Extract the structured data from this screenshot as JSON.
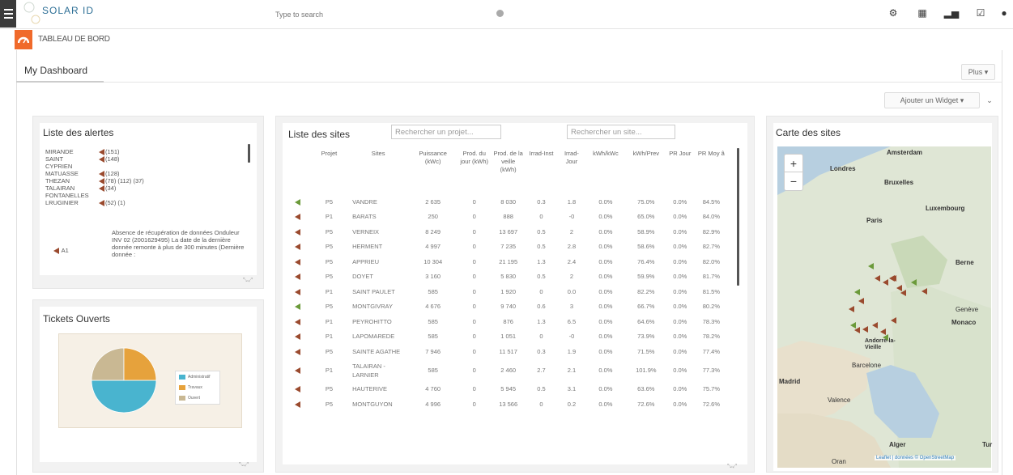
{
  "header": {
    "logo_text": "SOLAR ID",
    "search_placeholder": "Type to search",
    "icons": [
      "gear-icon",
      "calendar-icon",
      "chart-icon",
      "checkbox-icon",
      "user-icon"
    ]
  },
  "tab": {
    "title": "TABLEAU DE BORD"
  },
  "dashboard": {
    "title": "My Dashboard",
    "plus_label": "Plus ▾",
    "add_widget_label": "Ajouter un Widget ▾"
  },
  "alerts": {
    "title": "Liste des alertes",
    "rows": [
      {
        "name": "MIRANDE",
        "flags": "(151)"
      },
      {
        "name": "SAINT",
        "flags": "(148)"
      },
      {
        "name": "CYPRIEN",
        "flags": ""
      },
      {
        "name": "MATUASSE",
        "flags": "(128)"
      },
      {
        "name": "THEZAN",
        "flags": "(78)  (112)  (37)"
      },
      {
        "name": "TALAIRAN",
        "flags": "(34)"
      },
      {
        "name": "FONTANELLES",
        "flags": ""
      },
      {
        "name": "LRUGINIER",
        "flags": "(52)  (1)"
      }
    ],
    "message": "Absence de récupération de données Onduleur INV 02 (2001629495) La date de la dernière donnée remonte à plus de 300 minutes (Dernière donnée :",
    "a1_label": "A1"
  },
  "tickets": {
    "title": "Tickets Ouverts",
    "legend": [
      "Administratif",
      "Travaux",
      "Ouvert"
    ],
    "colors": {
      "administratif": "#49b4cf",
      "travaux": "#e6a23c",
      "ouvert": "#c9b893"
    },
    "values": {
      "administratif": 50,
      "travaux": 25,
      "ouvert": 25
    }
  },
  "sites": {
    "title": "Liste des sites",
    "project_placeholder": "Rechercher un projet...",
    "site_placeholder": "Rechercher un site...",
    "columns": [
      "Projet",
      "Sites",
      "Puissance (kWc)",
      "Prod. du jour (kWh)",
      "Prod. de la veille (kWh)",
      "Irrad-Inst",
      "Irrad-Jour",
      "kWh/kWc",
      "kWh/Prev",
      "PR Jour",
      "PR Moy â"
    ],
    "rows": [
      {
        "flag": "g",
        "projet": "P5",
        "site": "VANDRE",
        "puissance": "2 635",
        "prod_jour": "0",
        "prod_veille": "8 030",
        "irr_inst": "0.3",
        "irr_jour": "1.8",
        "kwh_kwc": "0.0%",
        "kwh_prev": "75.0%",
        "pr_jour": "0.0%",
        "pr_moy": "84.5%"
      },
      {
        "flag": "r",
        "projet": "P1",
        "site": "BARATS",
        "puissance": "250",
        "prod_jour": "0",
        "prod_veille": "888",
        "irr_inst": "0",
        "irr_jour": "-0",
        "kwh_kwc": "0.0%",
        "kwh_prev": "65.0%",
        "pr_jour": "0.0%",
        "pr_moy": "84.0%"
      },
      {
        "flag": "r",
        "projet": "P5",
        "site": "VERNEIX",
        "puissance": "8 249",
        "prod_jour": "0",
        "prod_veille": "13 697",
        "irr_inst": "0.5",
        "irr_jour": "2",
        "kwh_kwc": "0.0%",
        "kwh_prev": "58.9%",
        "pr_jour": "0.0%",
        "pr_moy": "82.9%"
      },
      {
        "flag": "r",
        "projet": "P5",
        "site": "HERMENT",
        "puissance": "4 997",
        "prod_jour": "0",
        "prod_veille": "7 235",
        "irr_inst": "0.5",
        "irr_jour": "2.8",
        "kwh_kwc": "0.0%",
        "kwh_prev": "58.6%",
        "pr_jour": "0.0%",
        "pr_moy": "82.7%"
      },
      {
        "flag": "r",
        "projet": "P5",
        "site": "APPRIEU",
        "puissance": "10 304",
        "prod_jour": "0",
        "prod_veille": "21 195",
        "irr_inst": "1.3",
        "irr_jour": "2.4",
        "kwh_kwc": "0.0%",
        "kwh_prev": "76.4%",
        "pr_jour": "0.0%",
        "pr_moy": "82.0%"
      },
      {
        "flag": "r",
        "projet": "P5",
        "site": "DOYET",
        "puissance": "3 160",
        "prod_jour": "0",
        "prod_veille": "5 830",
        "irr_inst": "0.5",
        "irr_jour": "2",
        "kwh_kwc": "0.0%",
        "kwh_prev": "59.9%",
        "pr_jour": "0.0%",
        "pr_moy": "81.7%"
      },
      {
        "flag": "r",
        "projet": "P1",
        "site": "SAINT PAULET",
        "puissance": "585",
        "prod_jour": "0",
        "prod_veille": "1 920",
        "irr_inst": "0",
        "irr_jour": "0.0",
        "kwh_kwc": "0.0%",
        "kwh_prev": "82.2%",
        "pr_jour": "0.0%",
        "pr_moy": "81.5%"
      },
      {
        "flag": "g",
        "projet": "P5",
        "site": "MONTGIVRAY",
        "puissance": "4 676",
        "prod_jour": "0",
        "prod_veille": "9 740",
        "irr_inst": "0.6",
        "irr_jour": "3",
        "kwh_kwc": "0.0%",
        "kwh_prev": "66.7%",
        "pr_jour": "0.0%",
        "pr_moy": "80.2%"
      },
      {
        "flag": "r",
        "projet": "P1",
        "site": "PEYROHITTO",
        "puissance": "585",
        "prod_jour": "0",
        "prod_veille": "876",
        "irr_inst": "1.3",
        "irr_jour": "6.5",
        "kwh_kwc": "0.0%",
        "kwh_prev": "64.6%",
        "pr_jour": "0.0%",
        "pr_moy": "78.3%"
      },
      {
        "flag": "r",
        "projet": "P1",
        "site": "LAPOMAREDE",
        "puissance": "585",
        "prod_jour": "0",
        "prod_veille": "1 051",
        "irr_inst": "0",
        "irr_jour": "-0",
        "kwh_kwc": "0.0%",
        "kwh_prev": "73.9%",
        "pr_jour": "0.0%",
        "pr_moy": "78.2%"
      },
      {
        "flag": "r",
        "projet": "P5",
        "site": "SAINTE AGATHE",
        "puissance": "7 946",
        "prod_jour": "0",
        "prod_veille": "11 517",
        "irr_inst": "0.3",
        "irr_jour": "1.9",
        "kwh_kwc": "0.0%",
        "kwh_prev": "71.5%",
        "pr_jour": "0.0%",
        "pr_moy": "77.4%"
      },
      {
        "flag": "r",
        "projet": "P1",
        "site": "TALAIRAN - LARNIER",
        "puissance": "585",
        "prod_jour": "0",
        "prod_veille": "2 460",
        "irr_inst": "2.7",
        "irr_jour": "2.1",
        "kwh_kwc": "0.0%",
        "kwh_prev": "101.9%",
        "pr_jour": "0.0%",
        "pr_moy": "77.3%",
        "tall": true
      },
      {
        "flag": "r",
        "projet": "P5",
        "site": "HAUTERIVE",
        "puissance": "4 760",
        "prod_jour": "0",
        "prod_veille": "5 945",
        "irr_inst": "0.5",
        "irr_jour": "3.1",
        "kwh_kwc": "0.0%",
        "kwh_prev": "63.6%",
        "pr_jour": "0.0%",
        "pr_moy": "75.7%"
      },
      {
        "flag": "r",
        "projet": "P5",
        "site": "MONTGUYON",
        "puissance": "4 996",
        "prod_jour": "0",
        "prod_veille": "13 566",
        "irr_inst": "0",
        "irr_jour": "0.2",
        "kwh_kwc": "0.0%",
        "kwh_prev": "72.6%",
        "pr_jour": "0.0%",
        "pr_moy": "72.6%"
      }
    ],
    "flag_colors": {
      "r": "#9a4a2e",
      "g": "#6b9a3a"
    }
  },
  "map": {
    "title": "Carte des sites",
    "labels": [
      "Amsterdam",
      "Londres",
      "Bruxelles",
      "Luxembourg",
      "Paris",
      "Berne",
      "Genève",
      "Monaco",
      "Andorre-la-Vieille",
      "Barcelone",
      "Madrid",
      "Valence",
      "Alger",
      "Tur",
      "Oran"
    ],
    "attribution": "Leaflet | données © OpenStreetMap"
  }
}
